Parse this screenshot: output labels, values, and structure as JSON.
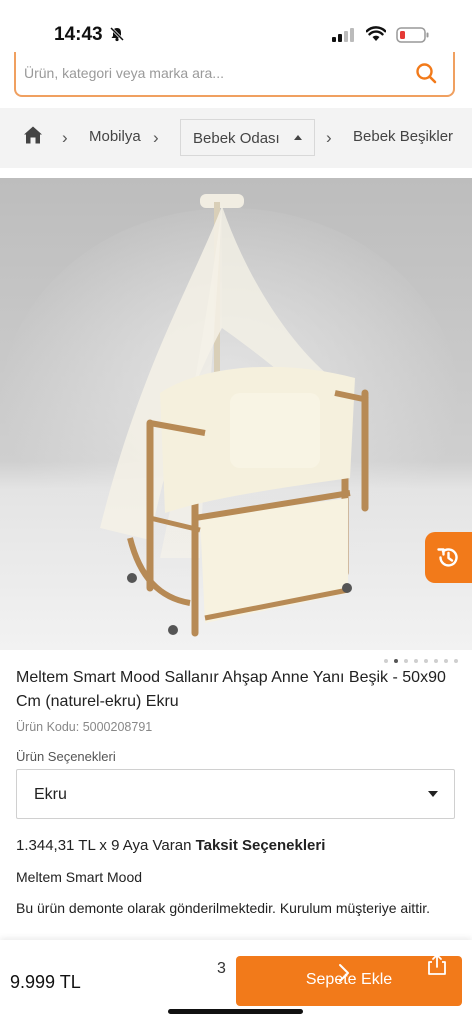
{
  "status_bar": {
    "time": "14:43",
    "icons": [
      "bell-slash-icon",
      "cellular-signal-icon",
      "wifi-icon",
      "battery-low-icon"
    ]
  },
  "search": {
    "placeholder": "Ürün, kategori veya marka ara...",
    "icon": "search-icon",
    "accent": "#f27a1a"
  },
  "breadcrumb": {
    "home_icon": "home-icon",
    "items": [
      "Mobilya",
      "Bebek Odası",
      "Bebek Beşikler"
    ],
    "selected_dropdown": "Bebek Odası"
  },
  "gallery": {
    "image_alt": "Beşik ürün fotoğrafı",
    "current_index": 2,
    "total": 8,
    "history_icon": "history-icon"
  },
  "product": {
    "title": "Meltem Smart Mood Sallanır Ahşap Anne Yanı Beşik - 50x90 Cm (naturel-ekru) Ekru",
    "code": "Ürün Kodu: 5000208791",
    "options_label": "Ürün Seçenekleri",
    "selected_option": "Ekru",
    "installment_prefix": "1.344,31 TL x 9 Aya Varan ",
    "installment_link": "Taksit Seçenekleri",
    "brand": "Meltem Smart Mood",
    "info": "Bu ürün demonte olarak gönderilmektedir. Kurulum müşteriye aittir."
  },
  "bottom_bar": {
    "price": "9.999 TL",
    "page_indicator": "3",
    "add_to_cart": "Sepete Ekle"
  },
  "colors": {
    "brand_orange": "#f27a1a",
    "breadcrumb_bg": "#f3f3f3"
  }
}
